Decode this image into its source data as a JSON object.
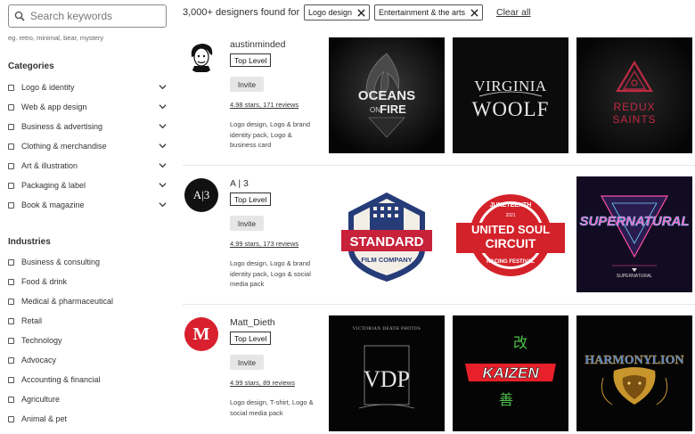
{
  "search": {
    "placeholder": "Search keywords",
    "hint": "eg. retro, minimal, bear, mystery"
  },
  "categories": {
    "title": "Categories",
    "items": [
      {
        "label": "Logo & identity"
      },
      {
        "label": "Web & app design"
      },
      {
        "label": "Business & advertising"
      },
      {
        "label": "Clothing & merchandise"
      },
      {
        "label": "Art & illustration"
      },
      {
        "label": "Packaging & label"
      },
      {
        "label": "Book & magazine"
      }
    ]
  },
  "industries": {
    "title": "Industries",
    "items": [
      {
        "label": "Business & consulting"
      },
      {
        "label": "Food & drink"
      },
      {
        "label": "Medical & pharmaceutical"
      },
      {
        "label": "Retail"
      },
      {
        "label": "Technology"
      },
      {
        "label": "Advocacy"
      },
      {
        "label": "Accounting & financial"
      },
      {
        "label": "Agriculture"
      },
      {
        "label": "Animal & pet"
      }
    ]
  },
  "results": {
    "count_text": "3,000+ designers found for",
    "filters": [
      {
        "label": "Logo design"
      },
      {
        "label": "Entertainment & the arts"
      }
    ],
    "clear_all": "Clear all"
  },
  "designers": [
    {
      "name": "austinminded",
      "level": "Top Level",
      "invite": "Invite",
      "rating": "4.98 stars, 171 reviews",
      "specialties": "Logo design, Logo & brand identity pack, Logo & business card",
      "avatar_text": "",
      "portfolio": [
        {
          "line1": "OCEANS",
          "line2": "ON",
          "line3": "FIRE"
        },
        {
          "line1": "VIRGINIA",
          "line2": "WOOLF"
        },
        {
          "line1": "REDUX",
          "line2": "SAINTS"
        }
      ]
    },
    {
      "name": "A | 3",
      "level": "Top Level",
      "invite": "Invite",
      "rating": "4.99 stars, 173 reviews",
      "specialties": "Logo design, Logo & brand identity pack, Logo & social media pack",
      "avatar_text": "A|3",
      "portfolio": [
        {
          "line1": "STANDARD",
          "line2": "FILM COMPANY"
        },
        {
          "line1": "JUNETEENTH",
          "line2": "2021",
          "line3": "UNITED SOUL",
          "line4": "CIRCUIT",
          "line5": "RACING FESTIVAL"
        },
        {
          "line1": "SUPERNATURAL",
          "line2": "SUPERNATURAL"
        }
      ]
    },
    {
      "name": "Matt_Dieth",
      "level": "Top Level",
      "invite": "Invite",
      "rating": "4.99 stars, 89 reviews",
      "specialties": "Logo design, T-shirt, Logo & social media pack",
      "avatar_text": "M",
      "portfolio": [
        {
          "line1": "VICTORIAN DEATH PHOTOS",
          "line2": "VDP"
        },
        {
          "line1": "改",
          "line2": "KAIZEN",
          "line3": "善"
        },
        {
          "line1": "HARMONYLION"
        }
      ]
    }
  ],
  "colors": {
    "accent_red": "#d9202e",
    "text": "#333333",
    "invite_bg": "#e6e6e6",
    "standard_blue": "#263c78",
    "soul_red": "#d4222a"
  }
}
